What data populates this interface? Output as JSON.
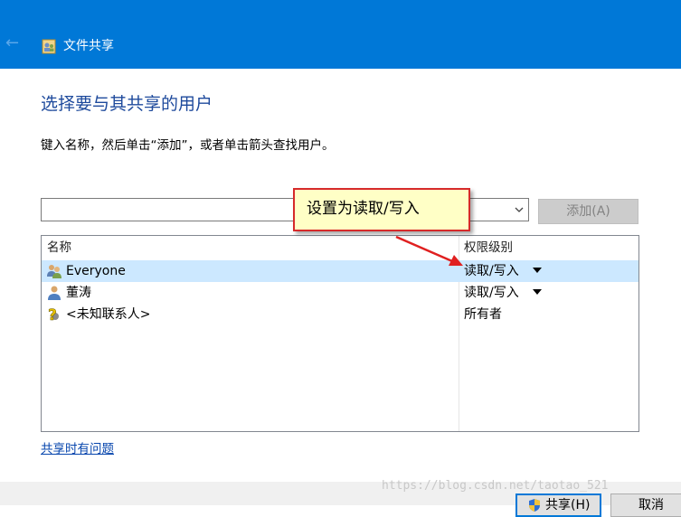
{
  "window": {
    "title": "文件共享",
    "back_glyph": "←"
  },
  "heading": "选择要与其共享的用户",
  "instruction": "键入名称，然后单击“添加”，或者单击箭头查找用户。",
  "name_input": {
    "value": "",
    "placeholder": ""
  },
  "add_button": "添加(A)",
  "list": {
    "columns": [
      "名称",
      "权限级别"
    ],
    "rows": [
      {
        "name": "Everyone",
        "permission": "读取/写入",
        "icon": "group-users-icon",
        "selected": true,
        "has_dropdown": true
      },
      {
        "name": "董涛",
        "permission": "读取/写入",
        "icon": "user-icon",
        "selected": false,
        "has_dropdown": true
      },
      {
        "name": "<未知联系人>",
        "permission": "所有者",
        "icon": "unknown-contact-icon",
        "selected": false,
        "has_dropdown": false
      }
    ]
  },
  "help_link": "共享时有问题",
  "callout": "设置为读取/写入",
  "footer": {
    "share_button": "共享(H)",
    "cancel_button": "取消"
  },
  "watermark": "https://blog.csdn.net/taotao_521",
  "colors": {
    "titlebar": "#0078d7",
    "heading": "#1e4a9c",
    "selection": "#cce8ff",
    "callout_border": "#d62a2a",
    "callout_fill": "#ffffc6",
    "link": "#0645ad"
  }
}
